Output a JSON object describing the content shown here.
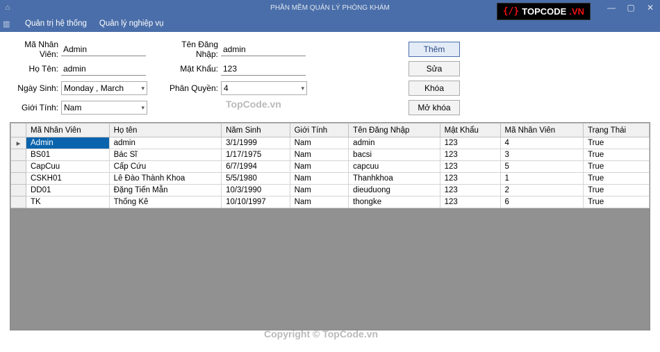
{
  "window": {
    "title": "PHẦN MỀM QUẢN LÝ PHÒNG KHÁM"
  },
  "menu": {
    "item1": "Quản trị hệ thống",
    "item2": "Quản lý nghiệp vụ"
  },
  "form": {
    "maNV_label": "Mã Nhân Viên:",
    "maNV_value": "Admin",
    "hoTen_label": "Họ Tên:",
    "hoTen_value": "admin",
    "ngaySinh_label": "Ngày Sinh:",
    "ngaySinh_value": "Monday , March",
    "gioiTinh_label": "Giới Tính:",
    "gioiTinh_value": "Nam",
    "tenDN_label": "Tên Đăng Nhập:",
    "tenDN_value": "admin",
    "matKhau_label": "Mật Khẩu:",
    "matKhau_value": "123",
    "phanQuyen_label": "Phân Quyền:",
    "phanQuyen_value": "4"
  },
  "buttons": {
    "them": "Thêm",
    "sua": "Sửa",
    "khoa": "Khóa",
    "moKhoa": "Mở khóa"
  },
  "grid": {
    "headers": {
      "c1": "Mã Nhân Viên",
      "c2": "Họ tên",
      "c3": "Năm Sinh",
      "c4": "Giới Tính",
      "c5": "Tên Đăng Nhập",
      "c6": "Mật Khẩu",
      "c7": "Mã Nhân Viên",
      "c8": "Trạng Thái"
    },
    "rows": [
      {
        "c1": "Admin",
        "c2": "admin",
        "c3": "3/1/1999",
        "c4": "Nam",
        "c5": "admin",
        "c6": "123",
        "c7": "4",
        "c8": "True"
      },
      {
        "c1": "BS01",
        "c2": "Bác Sĩ",
        "c3": "1/17/1975",
        "c4": "Nam",
        "c5": "bacsi",
        "c6": "123",
        "c7": "3",
        "c8": "True"
      },
      {
        "c1": "CapCuu",
        "c2": "Cấp Cứu",
        "c3": "6/7/1994",
        "c4": "Nam",
        "c5": "capcuu",
        "c6": "123",
        "c7": "5",
        "c8": "True"
      },
      {
        "c1": "CSKH01",
        "c2": "Lê Đào Thành Khoa",
        "c3": "5/5/1980",
        "c4": "Nam",
        "c5": "Thanhkhoa",
        "c6": "123",
        "c7": "1",
        "c8": "True"
      },
      {
        "c1": "DD01",
        "c2": "Đặng Tiến Mẫn",
        "c3": "10/3/1990",
        "c4": "Nam",
        "c5": "dieuduong",
        "c6": "123",
        "c7": "2",
        "c8": "True"
      },
      {
        "c1": "TK",
        "c2": "Thống Kê",
        "c3": "10/10/1997",
        "c4": "Nam",
        "c5": "thongke",
        "c6": "123",
        "c7": "6",
        "c8": "True"
      }
    ]
  },
  "watermark": {
    "wm1": "TopCode.vn",
    "wm2": "Copyright © TopCode.vn"
  },
  "logo": {
    "text1": "TOPCODE",
    "text2": ".VN"
  }
}
